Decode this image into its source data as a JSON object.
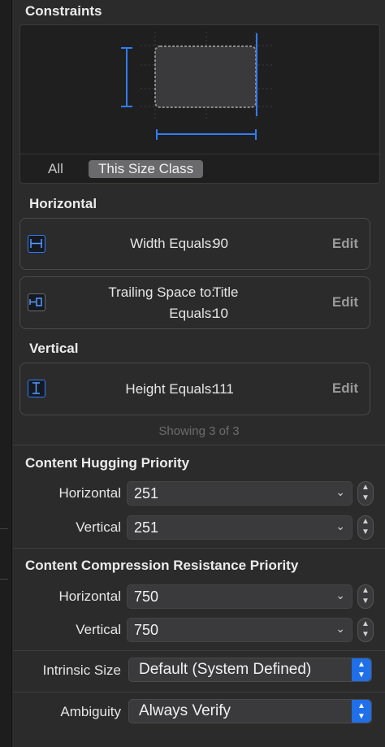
{
  "constraints": {
    "title": "Constraints",
    "segments": {
      "all": "All",
      "this_size_class": "This Size Class"
    }
  },
  "horizontal": {
    "title": "Horizontal",
    "items": [
      {
        "label": "Width Equals:",
        "value": "90",
        "edit": "Edit",
        "icon": "width-constraint-icon"
      },
      {
        "label_line1": "Trailing Space to:",
        "value_line1": "Title",
        "label_line2": "Equals:",
        "value_line2": "10",
        "edit": "Edit",
        "icon": "trailing-space-icon"
      }
    ]
  },
  "vertical": {
    "title": "Vertical",
    "items": [
      {
        "label": "Height Equals:",
        "value": "111",
        "edit": "Edit",
        "icon": "height-constraint-icon"
      }
    ]
  },
  "showing": "Showing 3 of 3",
  "content_hugging": {
    "title": "Content Hugging Priority",
    "horizontal_label": "Horizontal",
    "horizontal_value": "251",
    "vertical_label": "Vertical",
    "vertical_value": "251"
  },
  "compression": {
    "title": "Content Compression Resistance Priority",
    "horizontal_label": "Horizontal",
    "horizontal_value": "750",
    "vertical_label": "Vertical",
    "vertical_value": "750"
  },
  "intrinsic_size": {
    "label": "Intrinsic Size",
    "value": "Default (System Defined)"
  },
  "ambiguity": {
    "label": "Ambiguity",
    "value": "Always Verify"
  },
  "colors": {
    "accent": "#2f7df6",
    "background": "#2b2b2c"
  }
}
